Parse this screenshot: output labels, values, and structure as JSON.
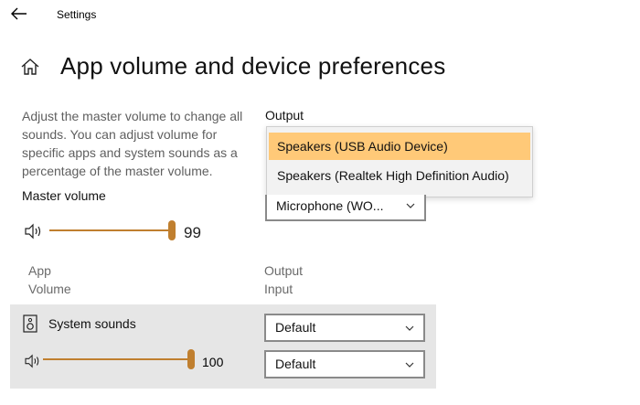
{
  "titlebar": {
    "back_icon": "back-arrow-icon",
    "title": "Settings"
  },
  "page": {
    "home_icon": "home-icon",
    "title": "App volume and device preferences"
  },
  "description": "Adjust the master volume to change all sounds. You can adjust volume for specific apps and system sounds as a percentage of the master volume.",
  "master": {
    "label": "Master volume",
    "value": "99",
    "level": 0.99,
    "icon": "speaker-icon"
  },
  "output": {
    "label": "Output",
    "dropdown_options": [
      "Speakers (USB Audio Device)",
      "Speakers (Realtek High Definition Audio)"
    ],
    "selected_option": "Speakers (USB Audio Device)"
  },
  "input": {
    "selected": "Microphone (WO..."
  },
  "columns": {
    "app_label": "App",
    "volume_label": "Volume",
    "output_label": "Output",
    "input_label": "Input"
  },
  "system_sounds": {
    "label": "System sounds",
    "icon": "speaker-box-icon",
    "value": "100",
    "level": 1.0,
    "output_selected": "Default",
    "input_selected": "Default"
  },
  "colors": {
    "accent": "#c07f2f",
    "highlight": "#ffc978",
    "row_bg": "#e6e6e6"
  }
}
